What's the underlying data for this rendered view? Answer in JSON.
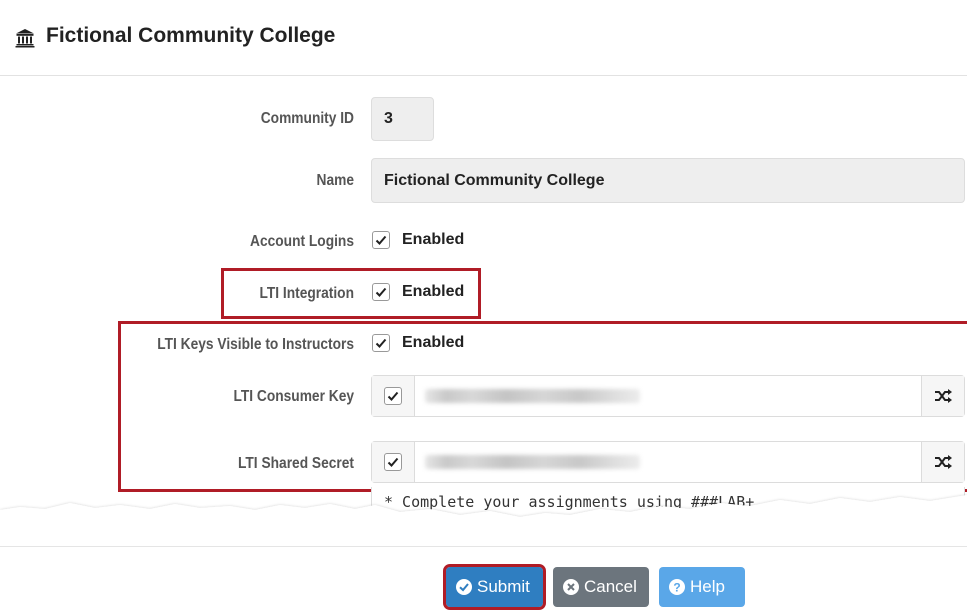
{
  "header": {
    "title": "Fictional Community College",
    "icon": "institution-icon"
  },
  "form": {
    "community_id": {
      "label": "Community ID",
      "value": "3"
    },
    "name": {
      "label": "Name",
      "value": "Fictional Community College"
    },
    "account_logins": {
      "label": "Account Logins",
      "checked": true,
      "option": "Enabled"
    },
    "lti_integration": {
      "label": "LTI Integration",
      "checked": true,
      "option": "Enabled"
    },
    "lti_keys_visible": {
      "label": "LTI Keys Visible to Instructors",
      "checked": true,
      "option": "Enabled"
    },
    "lti_consumer_key": {
      "label": "LTI Consumer Key",
      "checked": true,
      "value_obscured": true
    },
    "lti_shared_secret": {
      "label": "LTI Shared Secret",
      "checked": true,
      "value_obscured": true
    },
    "notes_textarea": {
      "visible_text": "* Complete your assignments using ###LAB+"
    }
  },
  "buttons": {
    "submit": "Submit",
    "cancel": "Cancel",
    "help": "Help"
  },
  "colors": {
    "highlight": "#b01c26",
    "submit": "#2f7ec1",
    "cancel": "#6c757d",
    "help": "#5aa7e8"
  }
}
